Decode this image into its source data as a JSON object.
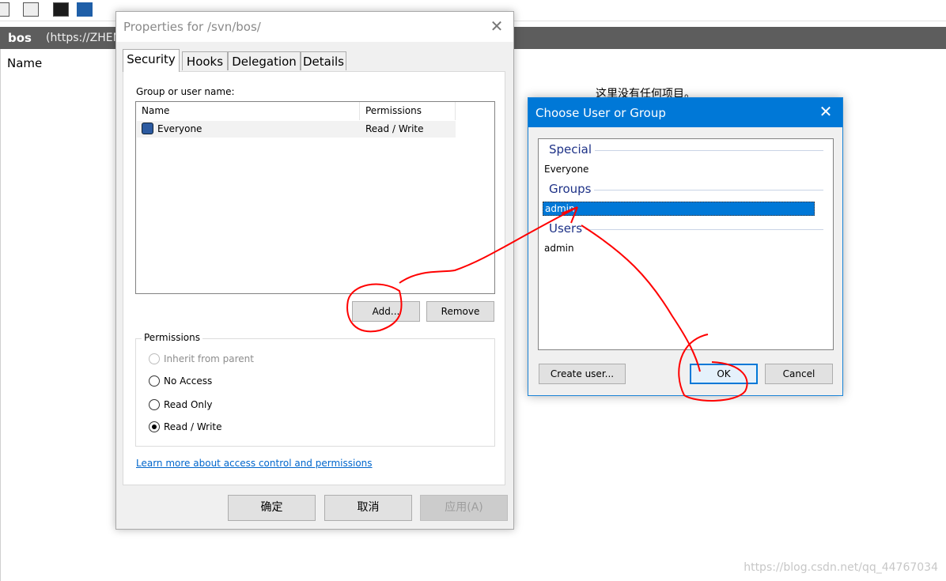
{
  "background": {
    "repo_name": "bos",
    "repo_url": "(https://ZHEN",
    "column_name": "Name",
    "empty_message": "这里没有任何项目。",
    "watermark": "https://blog.csdn.net/qq_44767034"
  },
  "properties_dialog": {
    "title": "Properties for /svn/bos/",
    "tabs": [
      "Security",
      "Hooks",
      "Delegation",
      "Details"
    ],
    "group_label": "Group or user name:",
    "columns": [
      "Name",
      "Permissions"
    ],
    "rows": [
      {
        "name": "Everyone",
        "permission": "Read / Write"
      }
    ],
    "add_button": "Add...",
    "remove_button": "Remove",
    "permissions_title": "Permissions",
    "radios": [
      {
        "label": "Inherit from parent",
        "checked": false,
        "disabled": true
      },
      {
        "label": "No Access",
        "checked": false,
        "disabled": false
      },
      {
        "label": "Read Only",
        "checked": false,
        "disabled": false
      },
      {
        "label": "Read / Write",
        "checked": true,
        "disabled": false
      }
    ],
    "learn_more_link": "Learn more about access control and permissions",
    "ok_button": "确定",
    "cancel_button": "取消",
    "apply_button": "应用(A)"
  },
  "choose_dialog": {
    "title": "Choose User or Group",
    "sections": {
      "special": {
        "title": "Special",
        "items": [
          "Everyone"
        ]
      },
      "groups": {
        "title": "Groups",
        "items": [
          "admin"
        ]
      },
      "users": {
        "title": "Users",
        "items": [
          "admin"
        ]
      }
    },
    "selected_group": "admin",
    "create_user_button": "Create user...",
    "ok_button": "OK",
    "cancel_button": "Cancel",
    "primary_color": "#0078d7"
  },
  "annotation_color": "#ff0000"
}
